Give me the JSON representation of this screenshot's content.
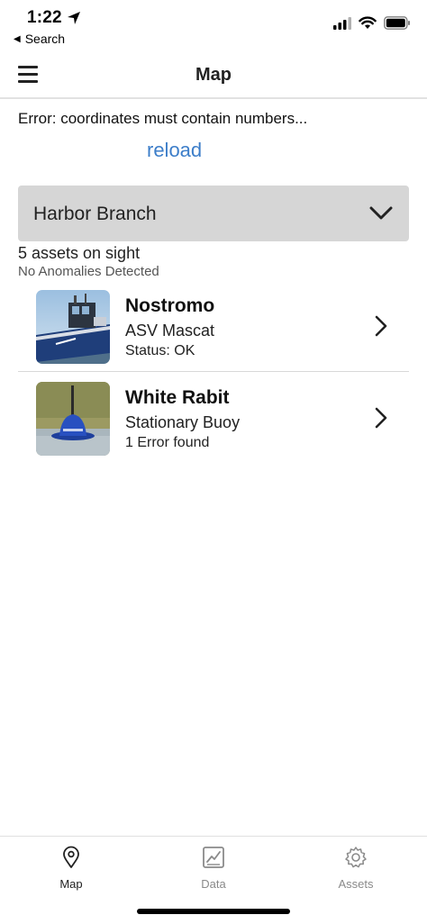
{
  "status_bar": {
    "time": "1:22",
    "back_label": "Search",
    "icons": [
      "location-arrow-icon",
      "cellular-signal-icon",
      "wifi-icon",
      "battery-icon"
    ]
  },
  "nav": {
    "title": "Map",
    "menu_icon": "hamburger-menu-icon"
  },
  "error": {
    "message": "Error: coordinates must contain numbers...",
    "reload_label": "reload",
    "reload_color": "#3d7ec9"
  },
  "location_select": {
    "selected": "Harbor Branch",
    "background": "#d6d6d6"
  },
  "summary": {
    "asset_count": "5 assets on sight",
    "anomalies": "No Anomalies Detected"
  },
  "assets": [
    {
      "name": "Nostromo",
      "type": "ASV Mascat",
      "status": "Status: OK",
      "thumb": "boat-photo"
    },
    {
      "name": "White Rabit",
      "type": "Stationary Buoy",
      "status": "1 Error found",
      "thumb": "buoy-photo"
    }
  ],
  "tabs": [
    {
      "label": "Map",
      "icon": "map-pin-icon",
      "active": true
    },
    {
      "label": "Data",
      "icon": "chart-icon",
      "active": false
    },
    {
      "label": "Assets",
      "icon": "gear-icon",
      "active": false
    }
  ]
}
